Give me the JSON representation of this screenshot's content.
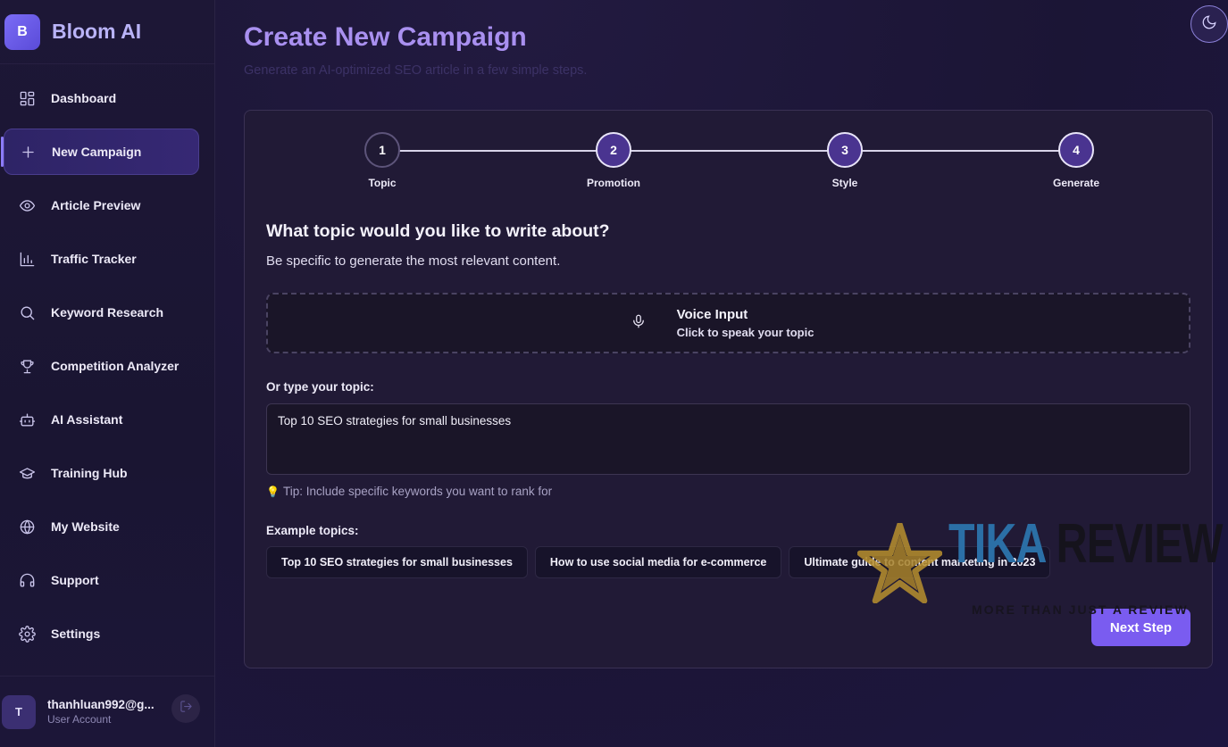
{
  "brand": {
    "logo_letter": "B",
    "name": "Bloom AI"
  },
  "sidebar": {
    "items": [
      {
        "label": "Dashboard",
        "icon": "dashboard-grid-icon"
      },
      {
        "label": "New Campaign",
        "icon": "plus-icon",
        "active": true
      },
      {
        "label": "Article Preview",
        "icon": "eye-icon"
      },
      {
        "label": "Traffic Tracker",
        "icon": "bar-chart-icon"
      },
      {
        "label": "Keyword Research",
        "icon": "search-icon"
      },
      {
        "label": "Competition Analyzer",
        "icon": "trophy-icon"
      },
      {
        "label": "AI Assistant",
        "icon": "robot-icon"
      },
      {
        "label": "Training Hub",
        "icon": "graduation-cap-icon"
      },
      {
        "label": "My Website",
        "icon": "globe-icon"
      },
      {
        "label": "Support",
        "icon": "headphones-icon"
      },
      {
        "label": "Settings",
        "icon": "gear-icon"
      }
    ]
  },
  "user": {
    "avatar_letter": "T",
    "email": "thanhluan992@g...",
    "role": "User Account"
  },
  "header": {
    "title": "Create New Campaign",
    "subtitle": "Generate an AI-optimized SEO article in a few simple steps."
  },
  "stepper": {
    "steps": [
      {
        "number": "1",
        "label": "Topic"
      },
      {
        "number": "2",
        "label": "Promotion"
      },
      {
        "number": "3",
        "label": "Style"
      },
      {
        "number": "4",
        "label": "Generate"
      }
    ],
    "current": 1
  },
  "topic_step": {
    "question": "What topic would you like to write about?",
    "description": "Be specific to generate the most relevant content.",
    "voice_title": "Voice Input",
    "voice_hint": "Click to speak your topic",
    "input_label": "Or type your topic:",
    "input_value": "Top 10 SEO strategies for small businesses",
    "tip": "Tip: Include specific keywords you want to rank for",
    "examples_label": "Example topics:",
    "examples": [
      "Top 10 SEO strategies for small businesses",
      "How to use social media for e-commerce",
      "Ultimate guide to content marketing in 2023"
    ]
  },
  "actions": {
    "next_label": "Next Step"
  },
  "watermark": {
    "title_a": "TIKA",
    "title_b": "REVIEW",
    "tagline": "MORE THAN JUST A REVIEW"
  },
  "colors": {
    "accent": "#7a5cf0",
    "title": "#a990f0",
    "background": "#1b1535"
  }
}
